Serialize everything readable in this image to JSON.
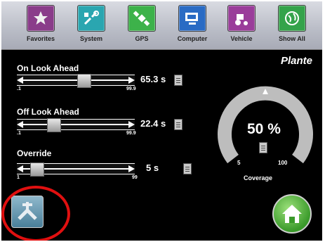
{
  "toolbar": {
    "buttons": [
      {
        "label": "Favorites",
        "color": "#8a3c8a"
      },
      {
        "label": "System",
        "color": "#2aa6b0"
      },
      {
        "label": "GPS",
        "color": "#3db24a"
      },
      {
        "label": "Computer",
        "color": "#2a6bc4"
      },
      {
        "label": "Vehicle",
        "color": "#9a3c9a"
      },
      {
        "label": "Show All",
        "color": "#34a34a"
      }
    ]
  },
  "screen_title": "Plante",
  "sliders": [
    {
      "label": "On Look Ahead",
      "value": "65.3",
      "unit": "s",
      "min": ".1",
      "max": "99.9",
      "level": 0.58
    },
    {
      "label": "Off Look Ahead",
      "value": "22.4",
      "unit": "s",
      "min": ".1",
      "max": "99.9",
      "level": 0.26
    },
    {
      "label": "Override",
      "value": "5",
      "unit": "s",
      "min": "1",
      "max": "99",
      "level": 0.08
    }
  ],
  "gauge": {
    "value": "50 %",
    "min": "5",
    "max": "100",
    "label": "Coverage",
    "level": 0.5
  },
  "colors": {
    "gauge": "#c8c8c8",
    "highlight_ring": "#e01010"
  },
  "icons": {
    "bottom_left": "wrench-icon",
    "bottom_right": "home-icon"
  }
}
